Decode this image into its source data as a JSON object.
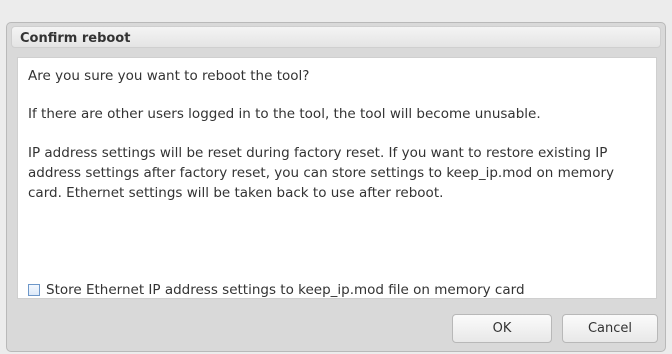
{
  "dialog": {
    "title": "Confirm reboot",
    "paragraphs": {
      "p1": "Are you sure you want to reboot the tool?",
      "p2": "If there are other users logged in to the tool, the tool will become unusable.",
      "p3": "IP address settings will be reset during factory reset. If you want to restore existing IP address settings after factory reset, you can store settings to keep_ip.mod on memory card. Ethernet settings will be taken back to use after reboot."
    },
    "checkbox": {
      "label": "Store Ethernet IP address settings to keep_ip.mod file on memory card",
      "checked": false
    },
    "buttons": {
      "ok": "OK",
      "cancel": "Cancel"
    }
  }
}
